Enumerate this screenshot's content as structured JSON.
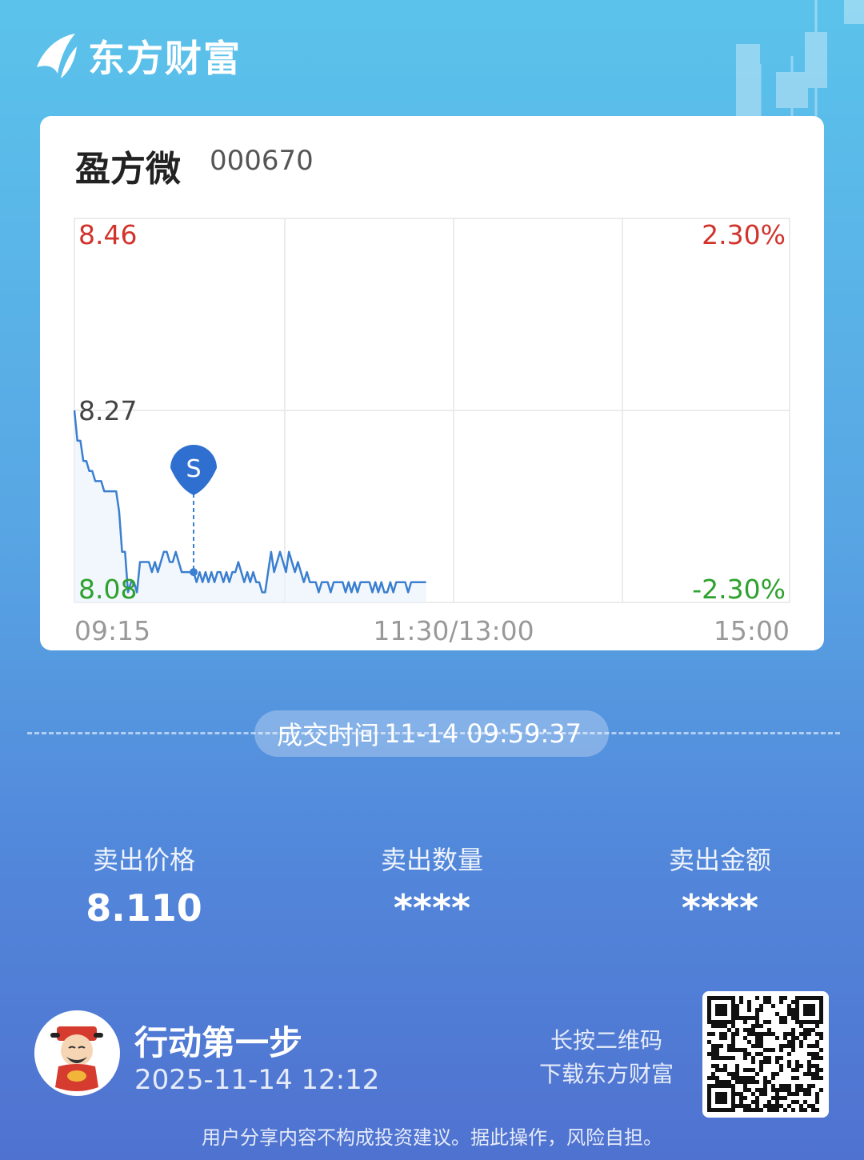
{
  "brand": {
    "name": "东方财富"
  },
  "stock": {
    "name": "盈方微",
    "code": "000670"
  },
  "chart_data": {
    "type": "line",
    "y_labels": {
      "top": "8.46",
      "mid": "8.27",
      "bottom": "8.08"
    },
    "pct_labels": {
      "top": "2.30%",
      "bottom": "-2.30%"
    },
    "x_labels": {
      "start": "09:15",
      "mid": "11:30/13:00",
      "end": "15:00"
    },
    "ylim": [
      8.08,
      8.46
    ],
    "prev_close": 8.27,
    "marker": {
      "label": "S",
      "index": 40,
      "price": 8.11
    },
    "colors": {
      "line": "#3b7fd0",
      "up": "#d0342c",
      "down": "#2ea12e",
      "neutral": "#444444"
    },
    "values": [
      8.27,
      8.24,
      8.24,
      8.22,
      8.22,
      8.21,
      8.21,
      8.2,
      8.2,
      8.2,
      8.19,
      8.19,
      8.19,
      8.19,
      8.19,
      8.17,
      8.13,
      8.13,
      8.09,
      8.1,
      8.1,
      8.09,
      8.12,
      8.12,
      8.12,
      8.12,
      8.11,
      8.12,
      8.11,
      8.12,
      8.13,
      8.13,
      8.12,
      8.12,
      8.13,
      8.12,
      8.11,
      8.11,
      8.11,
      8.11,
      8.11,
      8.1,
      8.11,
      8.1,
      8.11,
      8.1,
      8.11,
      8.1,
      8.11,
      8.11,
      8.1,
      8.11,
      8.1,
      8.11,
      8.11,
      8.12,
      8.11,
      8.1,
      8.11,
      8.1,
      8.11,
      8.1,
      8.1,
      8.09,
      8.09,
      8.11,
      8.13,
      8.11,
      8.12,
      8.13,
      8.12,
      8.11,
      8.13,
      8.12,
      8.11,
      8.12,
      8.11,
      8.1,
      8.11,
      8.1,
      8.1,
      8.1,
      8.09,
      8.1,
      8.1,
      8.1,
      8.09,
      8.1,
      8.1,
      8.1,
      8.1,
      8.09,
      8.1,
      8.09,
      8.1,
      8.09,
      8.1,
      8.1,
      8.1,
      8.1,
      8.09,
      8.1,
      8.09,
      8.1,
      8.09,
      8.09,
      8.1,
      8.09,
      8.1,
      8.1,
      8.1,
      8.1,
      8.09,
      8.1,
      8.1,
      8.1,
      8.1,
      8.1,
      8.1
    ]
  },
  "trade": {
    "time_label": "成交时间",
    "time_value": "11-14 09:59:37"
  },
  "stats": [
    {
      "label": "卖出价格",
      "value": "8.110"
    },
    {
      "label": "卖出数量",
      "value": "****"
    },
    {
      "label": "卖出金额",
      "value": "****"
    }
  ],
  "footer": {
    "slogan": "行动第一步",
    "date": "2025-11-14 12:12",
    "qr_hint_line1": "长按二维码",
    "qr_hint_line2": "下载东方财富",
    "disclaimer": "用户分享内容不构成投资建议。据此操作，风险自担。"
  }
}
